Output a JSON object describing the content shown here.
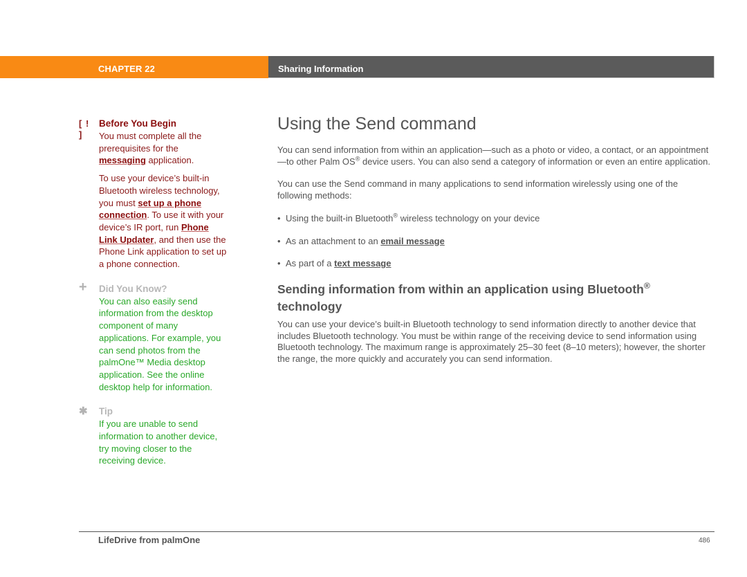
{
  "header": {
    "chapter": "CHAPTER 22",
    "section": "Sharing Information",
    "colors": {
      "chapter_bar": "#f98a14",
      "section_bar": "#5b5b5b"
    }
  },
  "sidebar": {
    "before_you_begin": {
      "icon": "exclamation-bracket-icon",
      "icon_text": "[ ! ]",
      "title": "Before You Begin",
      "p1_text": "You must complete all the prerequisites for the ",
      "p1_link": "messaging",
      "p1_end": " application.",
      "p2_a": "To use your device’s built-in Bluetooth wireless technology, you must ",
      "p2_link1": "set up a phone connection",
      "p2_b": ". To use it with your device’s IR port, run ",
      "p2_link2": "Phone Link Updater",
      "p2_c": ", and then use the Phone Link application to set up a phone connection."
    },
    "did_you_know": {
      "icon": "plus-icon",
      "icon_text": "+",
      "title": "Did You Know?",
      "body": "You can also easily send information from the desktop component of many applications. For example, you can send photos from the palmOne™ Media desktop application. See the online desktop help for information."
    },
    "tip": {
      "icon": "asterisk-icon",
      "icon_text": "✱",
      "title": "Tip",
      "body": "If you are unable to send information to another device, try moving closer to the receiving device."
    }
  },
  "main": {
    "title": "Using the Send command",
    "intro_a": "You can send information from within an application—such as a photo or video, a contact, or an appointment—to other Palm OS",
    "intro_sup": "®",
    "intro_b": " device users. You can also send a category of information or even an entire application.",
    "methods_intro": "You can use the Send command in many applications to send information wirelessly using one of the following methods:",
    "bullets": [
      {
        "text_a": "Using the built-in Bluetooth",
        "sup": "®",
        "text_b": " wireless technology on your device"
      },
      {
        "text_a": "As an attachment to an ",
        "link": "email message"
      },
      {
        "text_a": "As part of a ",
        "link": "text message"
      }
    ],
    "bullet_glyph": "•",
    "subhead_a": "Sending information from within an application using Bluetooth",
    "subhead_sup": "®",
    "subhead_b": " technology",
    "bluetooth_para": "You can use your device’s built-in Bluetooth technology to send information directly to another device that includes Bluetooth technology. You must be within range of the receiving device to send information using Bluetooth technology. The maximum range is approximately 25–30 feet (8–10 meters); however, the shorter the range, the more quickly and accurately you can send information."
  },
  "footer": {
    "book_title": "LifeDrive from palmOne",
    "page_number": "486"
  }
}
